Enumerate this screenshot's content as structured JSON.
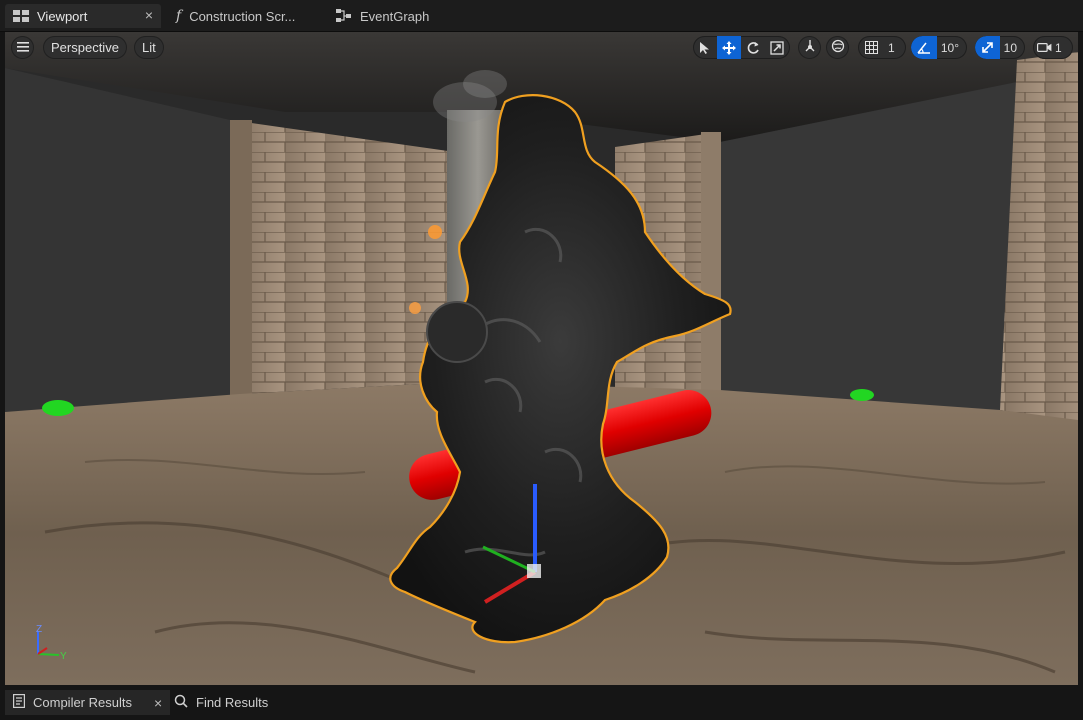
{
  "tabs": [
    {
      "label": "Viewport",
      "icon": "viewport-grid-icon",
      "active": true,
      "closable": true
    },
    {
      "label": "Construction Scr...",
      "icon": "function-icon",
      "active": false,
      "closable": false
    },
    {
      "label": "EventGraph",
      "icon": "graph-nodes-icon",
      "active": false,
      "closable": false
    }
  ],
  "viewport_toolbar": {
    "menu_icon": "hamburger-menu-icon",
    "view_mode": "Perspective",
    "lighting_mode": "Lit",
    "transform_tools": [
      "select-arrow-icon",
      "move-icon",
      "rotate-icon",
      "scale-icon"
    ],
    "active_tool": "move-icon",
    "grid_snap_value": "1",
    "rotation_snap_value": "10°",
    "scale_snap_value": "10",
    "camera_speed_value": "1",
    "accent_color": "#0e64d4"
  },
  "axis_labels": {
    "z": "Z",
    "y": "Y"
  },
  "bottom_tabs": [
    {
      "label": "Compiler Results",
      "icon": "compiler-results-icon",
      "active": true,
      "closable": true
    },
    {
      "label": "Find Results",
      "icon": "search-icon",
      "active": false,
      "closable": false
    }
  ],
  "close_glyph": "×"
}
